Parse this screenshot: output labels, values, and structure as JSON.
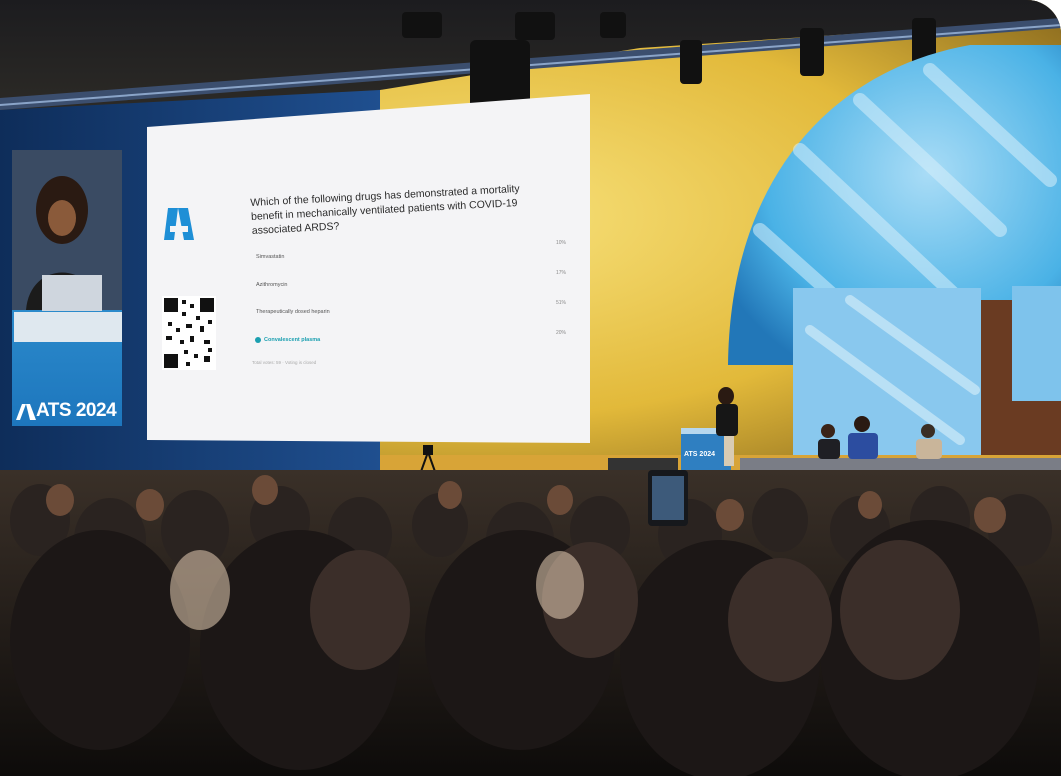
{
  "poll": {
    "question": "Which of the following drugs has demonstrated a mortality benefit in mechanically ventilated patients with COVID-19 associated ARDS?",
    "options": [
      {
        "label": "Simvastatin",
        "percent": "10%"
      },
      {
        "label": "Azithromycin",
        "percent": "17%"
      },
      {
        "label": "Therapeutically dosed heparin",
        "percent": "51%"
      },
      {
        "label": "Convalescent plasma",
        "percent": "20%"
      }
    ],
    "footer": "Total votes: 59 · Voting is closed"
  },
  "branding": {
    "side_screen_logo": "ATS 2024",
    "lectern_logo": "ATS 2024"
  },
  "colors": {
    "stage_yellow": "#f2d35a",
    "screen_white": "#f4f4f6",
    "brand_blue": "#1aa7e0",
    "accent_teal": "#1a9fb0"
  }
}
